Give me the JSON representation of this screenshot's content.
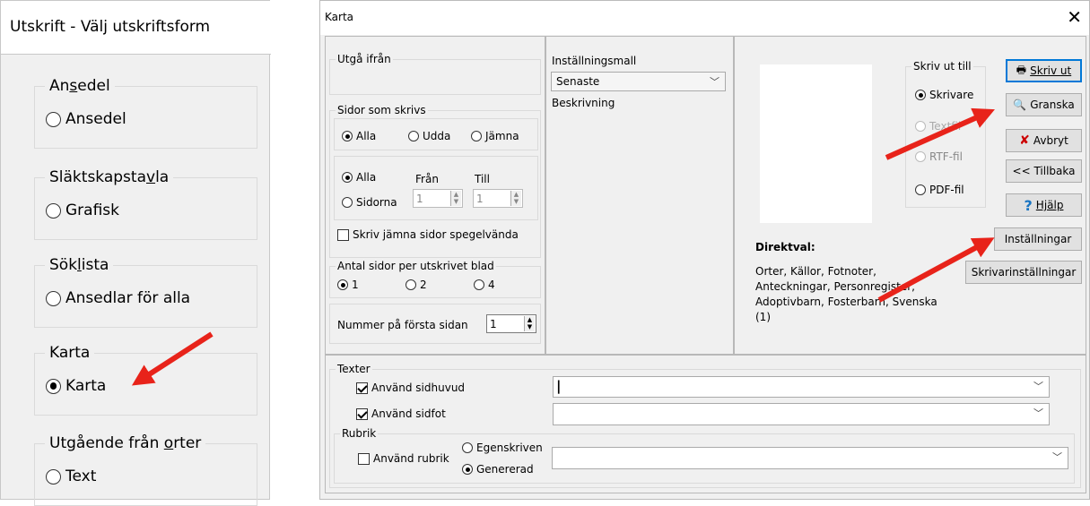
{
  "left_panel": {
    "title": "Utskrift - Välj utskriftsform",
    "groups": [
      {
        "legend_a": "An",
        "legend_u": "s",
        "legend_b": "edel",
        "option": "Ansedel",
        "selected": false
      },
      {
        "legend_a": "Släktskapsta",
        "legend_u": "v",
        "legend_b": "la",
        "option": "Grafisk",
        "selected": false
      },
      {
        "legend_a": "Sök",
        "legend_u": "l",
        "legend_b": "ista",
        "option": "Ansedlar för alla",
        "selected": false
      },
      {
        "legend_a": "Karta",
        "legend_u": "",
        "legend_b": "",
        "option": "Karta",
        "selected": true
      },
      {
        "legend_a": "Utgående från ",
        "legend_u": "o",
        "legend_b": "rter",
        "option": "Text",
        "selected": false
      }
    ]
  },
  "dialog": {
    "title": "Karta",
    "close": "✕",
    "left": {
      "utga_ifran": "Utgå ifrån",
      "sidor_som_skrivs": "Sidor som skrivs",
      "alla": "Alla",
      "udda": "Udda",
      "jamna": "Jämna",
      "alla2": "Alla",
      "sidorna": "Sidorna",
      "fran": "Från",
      "till": "Till",
      "fran_value": "1",
      "till_value": "1",
      "spegelvanda": "Skriv jämna sidor spegelvända",
      "antal_sidor": "Antal sidor per utskrivet blad",
      "one": "1",
      "two": "2",
      "four": "4",
      "nummer_forsta": "Nummer på första sidan",
      "nummer_value": "1"
    },
    "middle": {
      "installningsmall": "Inställningsmall",
      "mall_value": "Senaste",
      "beskrivning": "Beskrivning"
    },
    "right": {
      "skriv_ut_till": "Skriv ut till",
      "skrivare": "Skrivare",
      "textfil": "Textfil",
      "rtf": "RTF-fil",
      "pdf": "PDF-fil",
      "direktval_label": "Direktval:",
      "direktval_text_1": "Orter, Källor, Fotnoter,",
      "direktval_text_2": "Anteckningar, Personregister,",
      "direktval_text_3": "Adoptivbarn, Fosterbarn, Svenska",
      "direktval_text_4": "(1)"
    },
    "buttons": {
      "skriv_ut": "Skriv ut",
      "granska": "Granska",
      "avbryt": "Avbryt",
      "tillbaka": "<< Tillbaka",
      "hjalp": "Hjälp",
      "installningar": "Inställningar",
      "skrivarinstallningar": "Skrivarinställningar"
    },
    "texter": {
      "legend": "Texter",
      "sidhuvud": "Använd sidhuvud",
      "sidfot": "Använd sidfot",
      "rubrik_legend": "Rubrik",
      "anvand_rubrik": "Använd rubrik",
      "egenskriven": "Egenskriven",
      "genererad": "Genererad"
    }
  },
  "colors": {
    "arrow": "#e8231a",
    "focus": "#0078d7"
  }
}
